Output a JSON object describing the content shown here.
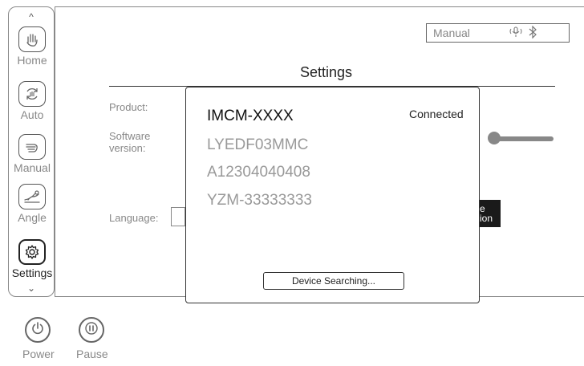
{
  "sidebar": {
    "scroll_up_glyph": "^",
    "scroll_down_glyph": "⌄",
    "items": [
      {
        "label": "Home",
        "icon": "hand-wave-icon"
      },
      {
        "label": "Auto",
        "icon": "auto-cycle-icon"
      },
      {
        "label": "Manual",
        "icon": "hand-icon"
      },
      {
        "label": "Angle",
        "icon": "angle-icon"
      },
      {
        "label": "Settings",
        "icon": "gear-icon"
      }
    ],
    "active": "Settings"
  },
  "status": {
    "mode": "Manual",
    "icons": [
      "microphone-icon",
      "bluetooth-icon"
    ]
  },
  "settings": {
    "title": "Settings",
    "product_label": "Product:",
    "software_label_line1": "Software",
    "software_label_line2": "version:",
    "language_label": "Language:",
    "dark_button_line1": "e",
    "dark_button_line2": "ion"
  },
  "modal": {
    "devices": [
      "IMCM-XXXX",
      "LYEDF03MMC",
      "A12304040408",
      "YZM-33333333"
    ],
    "connection_status": "Connected",
    "search_button_label": "Device Searching..."
  },
  "bottom": {
    "power_label": "Power",
    "pause_label": "Pause"
  },
  "colors": {
    "border": "#888888",
    "text_dark": "#222222",
    "text_muted": "#888888",
    "dark_button": "#1a1a1a"
  }
}
